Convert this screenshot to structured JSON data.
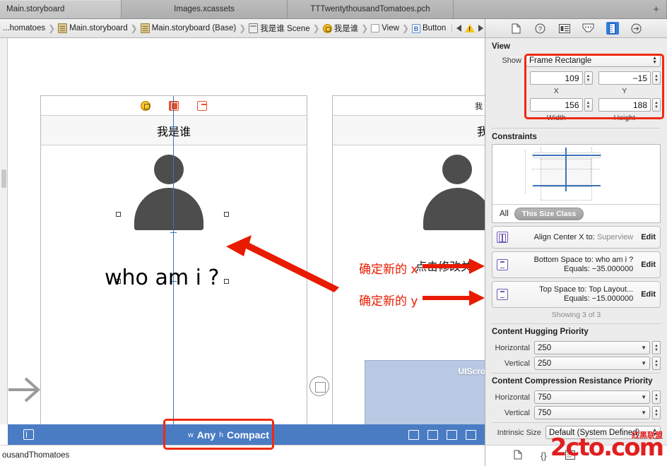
{
  "window": {
    "tabs": [
      {
        "label": "Main.storyboard",
        "active": true
      },
      {
        "label": "Images.xcassets",
        "active": false
      },
      {
        "label": "TTTwentythousandTomatoes.pch",
        "active": false
      }
    ],
    "add_tab_label": "+"
  },
  "jumpbar": {
    "crumbs": [
      {
        "label": "...homatoes",
        "icon": "none"
      },
      {
        "label": "Main.storyboard",
        "icon": "document-icon"
      },
      {
        "label": "Main.storyboard (Base)",
        "icon": "document-icon"
      },
      {
        "label": "我是谁 Scene",
        "icon": "scene-icon"
      },
      {
        "label": "我是谁",
        "icon": "view-controller-icon"
      },
      {
        "label": "View",
        "icon": "view-icon"
      },
      {
        "label": "Button",
        "icon": "button-icon"
      }
    ],
    "button_glyph": "B",
    "prev_label": "◀",
    "next_label": "▶",
    "warning_label": "!"
  },
  "canvas": {
    "scene_left": {
      "nav_title": "我是谁",
      "body_text": "who am i ?",
      "bar_icons": [
        "view-controller-icon",
        "first-responder-icon",
        "exit-icon"
      ]
    },
    "scene_right": {
      "status_text": "我",
      "nav_title": "我",
      "note_text": "点击修改关"
    },
    "annotations": [
      {
        "text": "确定新的 x",
        "color": "#e81b00"
      },
      {
        "text": "确定新的 y",
        "color": "#e81b00"
      }
    ],
    "scrollview_label": "UIScrollView"
  },
  "sizebar": {
    "width_prefix": "w",
    "width_value": "Any",
    "height_prefix": "h",
    "height_value": "Compact",
    "left_icon": "size-class-icon",
    "right_icons": [
      "align-icon",
      "pin-icon",
      "resolve-issues-icon",
      "resize-icon"
    ]
  },
  "bottombar": {
    "path_text": "ousandThomatoes"
  },
  "inspector": {
    "toolbar_icons": [
      {
        "name": "file-inspector-icon",
        "glyph": "▢",
        "active": false
      },
      {
        "name": "quick-help-inspector-icon",
        "glyph": "?",
        "active": false
      },
      {
        "name": "identity-inspector-icon",
        "glyph": "▤",
        "active": false
      },
      {
        "name": "attributes-inspector-icon",
        "glyph": "⬓",
        "active": false
      },
      {
        "name": "size-inspector-icon",
        "glyph": "▮",
        "active": true
      },
      {
        "name": "connections-inspector-icon",
        "glyph": "→",
        "active": false
      }
    ],
    "view_section": {
      "title": "View",
      "show_label": "Show",
      "show_value": "Frame Rectangle",
      "x_value": "109",
      "x_label": "X",
      "y_value": "−15",
      "y_label": "Y",
      "width_value": "156",
      "width_label": "Width",
      "height_value": "188",
      "height_label": "Height"
    },
    "constraints_section": {
      "title": "Constraints",
      "filter_all": "All",
      "filter_size_class": "This Size Class",
      "items": [
        {
          "icon": "align-center-x-icon",
          "line1_label": "Align Center X to:",
          "line1_value": "Superview",
          "line1_value_dim": true,
          "line2_label": "",
          "line2_value": "",
          "edit_label": "Edit"
        },
        {
          "icon": "vertical-space-icon",
          "line1_label": "Bottom Space to:",
          "line1_value": "who am i ?",
          "line1_value_dim": false,
          "line2_label": "Equals:",
          "line2_value": "−35.000000",
          "edit_label": "Edit"
        },
        {
          "icon": "vertical-space-icon",
          "line1_label": "Top Space to:",
          "line1_value": "Top Layout...",
          "line1_value_dim": false,
          "line2_label": "Equals:",
          "line2_value": "−15.000000",
          "edit_label": "Edit"
        }
      ],
      "showing_text": "Showing 3 of 3"
    },
    "hugging_section": {
      "title": "Content Hugging Priority",
      "horizontal_label": "Horizontal",
      "horizontal_value": "250",
      "vertical_label": "Vertical",
      "vertical_value": "250"
    },
    "compression_section": {
      "title": "Content Compression Resistance Priority",
      "horizontal_label": "Horizontal",
      "horizontal_value": "750",
      "vertical_label": "Vertical",
      "vertical_value": "750"
    },
    "intrinsic": {
      "label": "Intrinsic Size",
      "value": "Default (System Defined)"
    },
    "bottom_icons": [
      {
        "name": "file-template-icon",
        "glyph": "▢"
      },
      {
        "name": "code-snippet-icon",
        "glyph": "{}"
      },
      {
        "name": "media-library-icon",
        "glyph": "▤"
      }
    ]
  },
  "watermark": {
    "text": "2cto.com",
    "cn_text": "红黑联盟"
  },
  "colors": {
    "accent_blue": "#4a7cc4",
    "annotation_red": "#e81b00",
    "highlight_box": "#ef2a10",
    "constraint_blue": "#3a72b8",
    "scrollview_fill": "#b9c8e3"
  }
}
